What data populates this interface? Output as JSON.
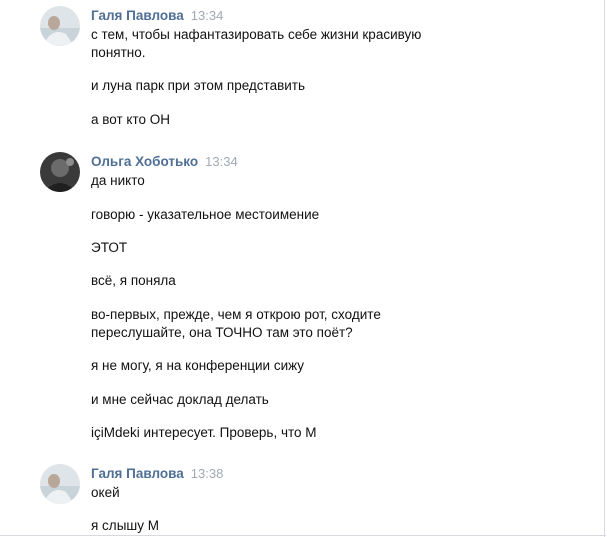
{
  "groups": [
    {
      "author": "Галя Павлова",
      "time": "13:34",
      "messages": [
        "с тем, чтобы нафантазировать себе жизни красивую\nпонятно.",
        "и луна парк при этом представить",
        "а вот кто ОН"
      ]
    },
    {
      "author": "Ольга Хоботько",
      "time": "13:34",
      "messages": [
        "да никто",
        "говорю - указательное местоимение",
        "ЭТОТ",
        "всё, я поняла",
        "во-первых, прежде, чем я открою рот, сходите\nпереслушайте, она ТОЧНО там это поёт?",
        "я не могу, я на конференции сижу",
        "и мне сейчас доклад делать",
        "içiMdeki интересует. Проверь, что М"
      ]
    },
    {
      "author": "Галя Павлова",
      "time": "13:38",
      "messages": [
        "окей",
        "я слышу М"
      ]
    }
  ]
}
